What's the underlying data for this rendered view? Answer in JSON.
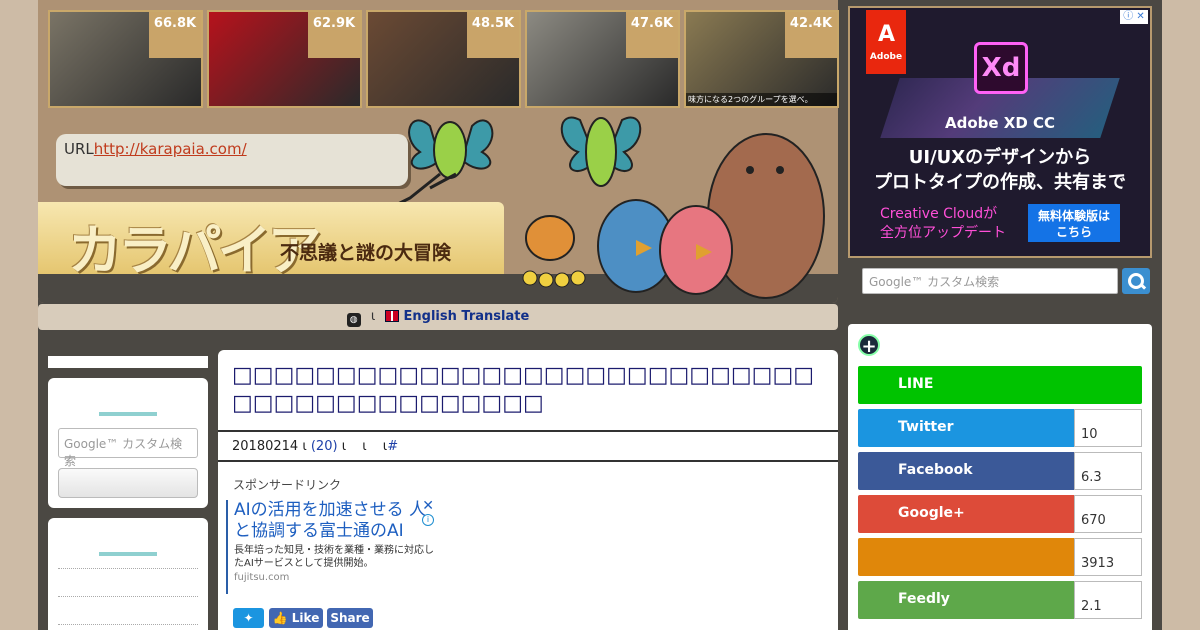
{
  "thumbnails": [
    {
      "count": "66.8K",
      "color": "#7a7466"
    },
    {
      "count": "62.9K",
      "color": "#b6121c"
    },
    {
      "count": "48.5K",
      "color": "#6b4a34"
    },
    {
      "count": "47.6K",
      "color": "#8c8a82"
    },
    {
      "count": "42.4K",
      "color": "#8a7a52",
      "caption": "味方になる2つのグループを選べ。"
    }
  ],
  "header": {
    "url_label": "URL",
    "url_link": "http://karapaia.com/",
    "logo_text": "カラパイア",
    "logo_sub": "不思議と謎の大冒険"
  },
  "translate": {
    "sep1": "ι",
    "label": "English Translate"
  },
  "ad": {
    "brand": "Adobe",
    "product_icon": "Xd",
    "product": "Adobe XD CC",
    "line1": "UI/UXのデザインから",
    "line2": "プロトタイプの作成、共有まで",
    "cc1": "Creative Cloudが",
    "cc2": "全方位アップデート",
    "cta1": "無料体験版は",
    "cta2": "こちら"
  },
  "search": {
    "placeholder": "Google™ カスタム検索"
  },
  "share": [
    {
      "label": "LINE",
      "count": "",
      "color": "#00c300",
      "full": true
    },
    {
      "label": "Twitter",
      "count": "10",
      "color": "#1b95e0"
    },
    {
      "label": "Facebook",
      "count": "6.3",
      "color": "#3b5998"
    },
    {
      "label": "Google+",
      "count": "670",
      "color": "#dd4b39"
    },
    {
      "label": "",
      "count": "3913",
      "color": "#e0870a"
    },
    {
      "label": "Feedly",
      "count": "2.1",
      "color": "#5ea84a"
    }
  ],
  "article": {
    "title": "□□□□□□□□□□□□□□□□□□□□□□□□□□□□□□□□□□□□□□□□□□□",
    "date": "20180214",
    "sep": "ι",
    "comments": "(20)",
    "hash": "#",
    "sponsor": "スポンサードリンク",
    "ad_headline": "AIの活用を加速させる 人と協調する富士通のAI",
    "ad_desc": "長年培った知見・技術を業種・業務に対応したAIサービスとして提供開始。",
    "ad_site": "fujitsu.com",
    "share_like": "Like",
    "share_share": "Share"
  }
}
